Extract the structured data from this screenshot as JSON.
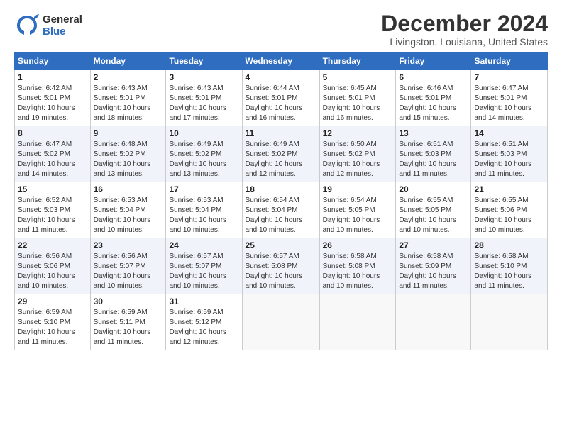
{
  "header": {
    "logo_general": "General",
    "logo_blue": "Blue",
    "month_title": "December 2024",
    "location": "Livingston, Louisiana, United States"
  },
  "days_of_week": [
    "Sunday",
    "Monday",
    "Tuesday",
    "Wednesday",
    "Thursday",
    "Friday",
    "Saturday"
  ],
  "weeks": [
    [
      {
        "day": "1",
        "sunrise": "6:42 AM",
        "sunset": "5:01 PM",
        "daylight": "10 hours and 19 minutes."
      },
      {
        "day": "2",
        "sunrise": "6:43 AM",
        "sunset": "5:01 PM",
        "daylight": "10 hours and 18 minutes."
      },
      {
        "day": "3",
        "sunrise": "6:43 AM",
        "sunset": "5:01 PM",
        "daylight": "10 hours and 17 minutes."
      },
      {
        "day": "4",
        "sunrise": "6:44 AM",
        "sunset": "5:01 PM",
        "daylight": "10 hours and 16 minutes."
      },
      {
        "day": "5",
        "sunrise": "6:45 AM",
        "sunset": "5:01 PM",
        "daylight": "10 hours and 16 minutes."
      },
      {
        "day": "6",
        "sunrise": "6:46 AM",
        "sunset": "5:01 PM",
        "daylight": "10 hours and 15 minutes."
      },
      {
        "day": "7",
        "sunrise": "6:47 AM",
        "sunset": "5:01 PM",
        "daylight": "10 hours and 14 minutes."
      }
    ],
    [
      {
        "day": "8",
        "sunrise": "6:47 AM",
        "sunset": "5:02 PM",
        "daylight": "10 hours and 14 minutes."
      },
      {
        "day": "9",
        "sunrise": "6:48 AM",
        "sunset": "5:02 PM",
        "daylight": "10 hours and 13 minutes."
      },
      {
        "day": "10",
        "sunrise": "6:49 AM",
        "sunset": "5:02 PM",
        "daylight": "10 hours and 13 minutes."
      },
      {
        "day": "11",
        "sunrise": "6:49 AM",
        "sunset": "5:02 PM",
        "daylight": "10 hours and 12 minutes."
      },
      {
        "day": "12",
        "sunrise": "6:50 AM",
        "sunset": "5:02 PM",
        "daylight": "10 hours and 12 minutes."
      },
      {
        "day": "13",
        "sunrise": "6:51 AM",
        "sunset": "5:03 PM",
        "daylight": "10 hours and 11 minutes."
      },
      {
        "day": "14",
        "sunrise": "6:51 AM",
        "sunset": "5:03 PM",
        "daylight": "10 hours and 11 minutes."
      }
    ],
    [
      {
        "day": "15",
        "sunrise": "6:52 AM",
        "sunset": "5:03 PM",
        "daylight": "10 hours and 11 minutes."
      },
      {
        "day": "16",
        "sunrise": "6:53 AM",
        "sunset": "5:04 PM",
        "daylight": "10 hours and 10 minutes."
      },
      {
        "day": "17",
        "sunrise": "6:53 AM",
        "sunset": "5:04 PM",
        "daylight": "10 hours and 10 minutes."
      },
      {
        "day": "18",
        "sunrise": "6:54 AM",
        "sunset": "5:04 PM",
        "daylight": "10 hours and 10 minutes."
      },
      {
        "day": "19",
        "sunrise": "6:54 AM",
        "sunset": "5:05 PM",
        "daylight": "10 hours and 10 minutes."
      },
      {
        "day": "20",
        "sunrise": "6:55 AM",
        "sunset": "5:05 PM",
        "daylight": "10 hours and 10 minutes."
      },
      {
        "day": "21",
        "sunrise": "6:55 AM",
        "sunset": "5:06 PM",
        "daylight": "10 hours and 10 minutes."
      }
    ],
    [
      {
        "day": "22",
        "sunrise": "6:56 AM",
        "sunset": "5:06 PM",
        "daylight": "10 hours and 10 minutes."
      },
      {
        "day": "23",
        "sunrise": "6:56 AM",
        "sunset": "5:07 PM",
        "daylight": "10 hours and 10 minutes."
      },
      {
        "day": "24",
        "sunrise": "6:57 AM",
        "sunset": "5:07 PM",
        "daylight": "10 hours and 10 minutes."
      },
      {
        "day": "25",
        "sunrise": "6:57 AM",
        "sunset": "5:08 PM",
        "daylight": "10 hours and 10 minutes."
      },
      {
        "day": "26",
        "sunrise": "6:58 AM",
        "sunset": "5:08 PM",
        "daylight": "10 hours and 10 minutes."
      },
      {
        "day": "27",
        "sunrise": "6:58 AM",
        "sunset": "5:09 PM",
        "daylight": "10 hours and 11 minutes."
      },
      {
        "day": "28",
        "sunrise": "6:58 AM",
        "sunset": "5:10 PM",
        "daylight": "10 hours and 11 minutes."
      }
    ],
    [
      {
        "day": "29",
        "sunrise": "6:59 AM",
        "sunset": "5:10 PM",
        "daylight": "10 hours and 11 minutes."
      },
      {
        "day": "30",
        "sunrise": "6:59 AM",
        "sunset": "5:11 PM",
        "daylight": "10 hours and 11 minutes."
      },
      {
        "day": "31",
        "sunrise": "6:59 AM",
        "sunset": "5:12 PM",
        "daylight": "10 hours and 12 minutes."
      },
      null,
      null,
      null,
      null
    ]
  ],
  "labels": {
    "sunrise": "Sunrise:",
    "sunset": "Sunset:",
    "daylight": "Daylight:"
  }
}
